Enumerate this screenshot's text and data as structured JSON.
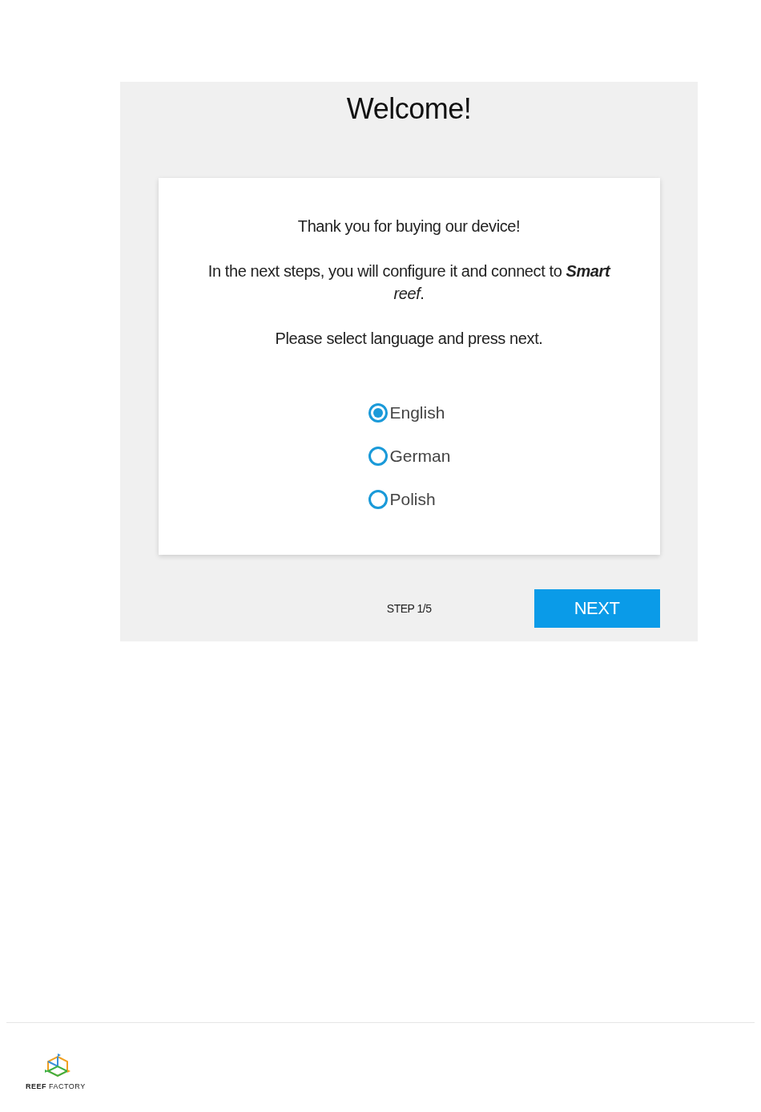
{
  "screen": {
    "title": "Welcome!",
    "messages": [
      "Thank you for buying our device!",
      "In the next steps, you will configure it and connect to **Smart** *reef*.",
      "Please select language and press next."
    ],
    "languages": [
      {
        "label": "English",
        "selected": true
      },
      {
        "label": "German",
        "selected": false
      },
      {
        "label": "Polish",
        "selected": false
      }
    ],
    "step": "STEP 1/5",
    "next_button": "NEXT"
  },
  "footer": {
    "logo_text": "**REEF** FACTORY"
  }
}
